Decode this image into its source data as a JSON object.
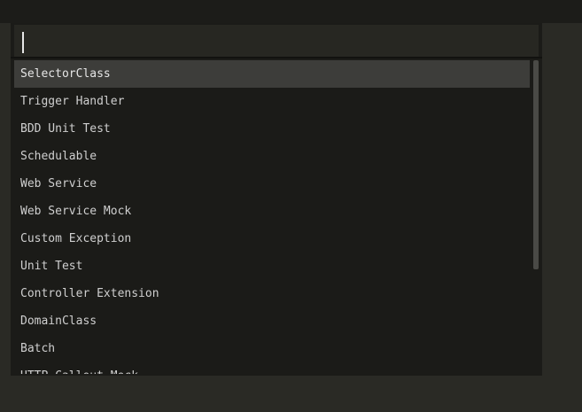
{
  "search": {
    "value": "",
    "placeholder": ""
  },
  "list": {
    "items": [
      {
        "label": "SelectorClass"
      },
      {
        "label": "Trigger Handler"
      },
      {
        "label": "BDD Unit Test"
      },
      {
        "label": "Schedulable"
      },
      {
        "label": "Web Service"
      },
      {
        "label": "Web Service Mock"
      },
      {
        "label": "Custom Exception"
      },
      {
        "label": "Unit Test"
      },
      {
        "label": "Controller Extension"
      },
      {
        "label": "DomainClass"
      },
      {
        "label": "Batch"
      },
      {
        "label": "HTTP Callout Mock"
      }
    ],
    "selected_index": 0
  },
  "colors": {
    "background": "#2a2a25",
    "palette_bg": "#1b1b18",
    "selected_bg": "#3d3d3a",
    "text": "#cfcfcf"
  }
}
